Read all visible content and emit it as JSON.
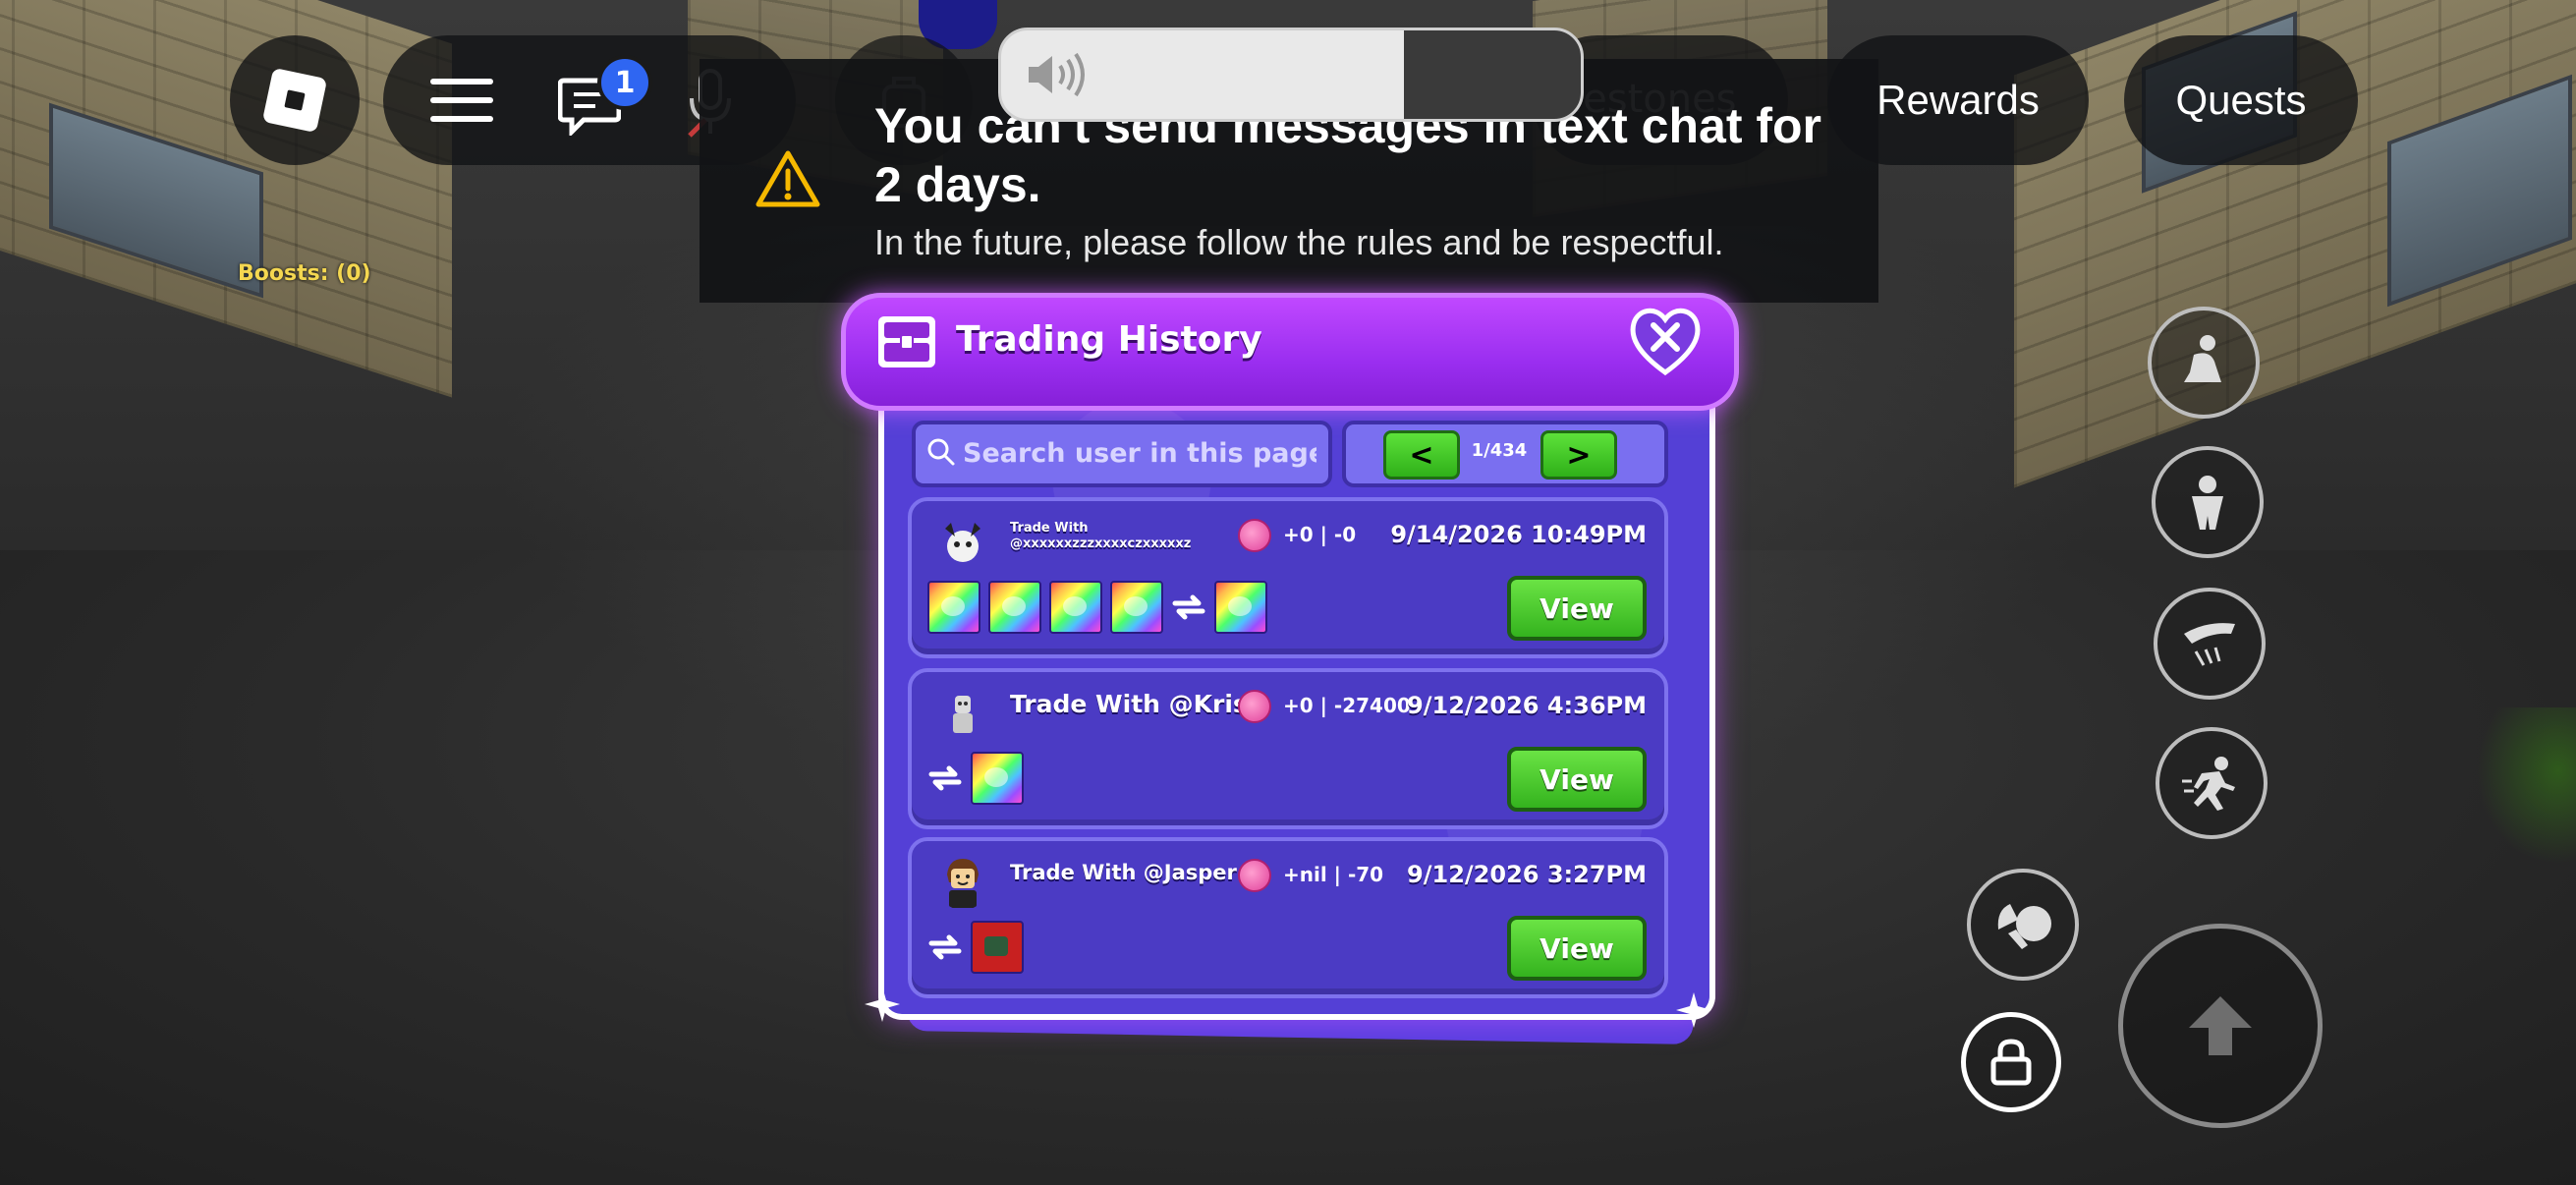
{
  "topbar": {
    "chat_badge": "1",
    "milestones_label": "lestones",
    "rewards_label": "Rewards",
    "quests_label": "Quests"
  },
  "boosts": "Boosts: (0)",
  "notification": {
    "title": "You can't send messages in text chat for 2 days.",
    "subtitle": "In the future, please follow the rules and be respectful."
  },
  "trading_history": {
    "title": "Trading History",
    "search_placeholder": "Search user in this page",
    "pager": {
      "prev": "<",
      "next": ">",
      "page": "1/434"
    },
    "trades": [
      {
        "title_line1": "Trade With",
        "title_line2": "@xxxxxxzzzxxxxczxxxxxz",
        "delta": "+0 | -0",
        "date": "9/14/2026 10:49PM",
        "view": "View"
      },
      {
        "title": "Trade With @Kris",
        "delta": "+0 | -27400",
        "date": "9/12/2026 4:36PM",
        "view": "View"
      },
      {
        "title": "Trade With @Jasper",
        "delta": "+nil | -70",
        "date": "9/12/2026 3:27PM",
        "view": "View"
      }
    ]
  },
  "colors": {
    "panel": "#5440d6",
    "header": "#a033f2",
    "view_button": "#3fc224",
    "badge": "#2f66f2",
    "boosts_text": "#f4d750"
  },
  "icons": [
    "roblox-logo-icon",
    "hamburger-menu-icon",
    "chat-icon",
    "microphone-icon",
    "backpack-icon",
    "volume-icon",
    "warning-icon",
    "chest-icon",
    "close-heart-icon",
    "search-icon",
    "swap-arrows-icon",
    "crouch-icon",
    "roll-icon",
    "dive-icon",
    "sprint-icon",
    "emote-icon",
    "shift-lock-icon",
    "jump-arrow-icon"
  ]
}
